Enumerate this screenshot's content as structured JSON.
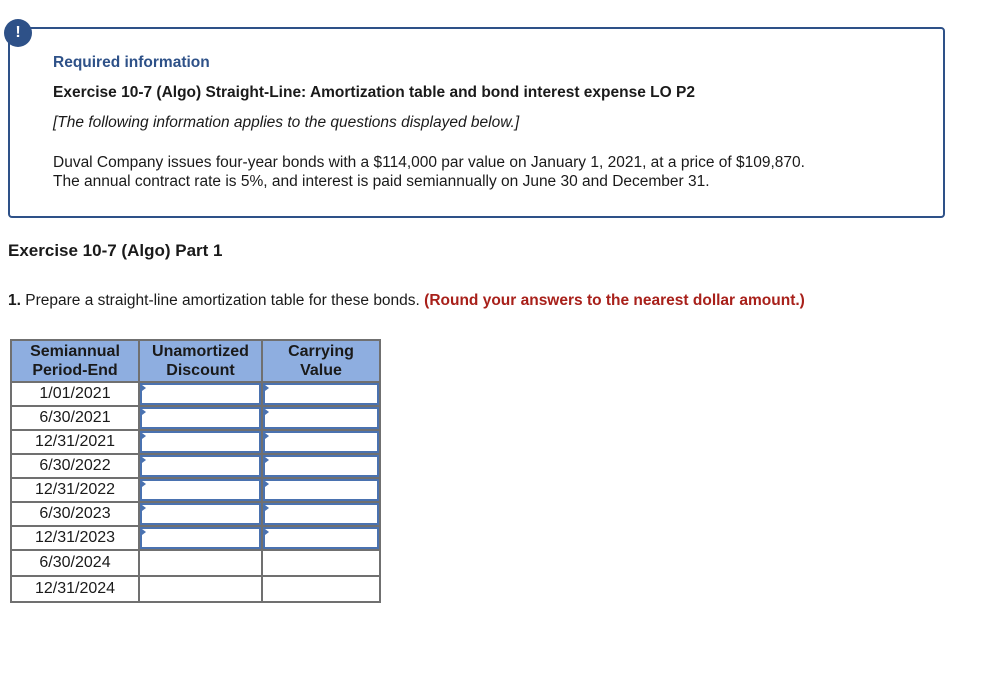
{
  "info_box": {
    "alert_icon": "!",
    "required_label": "Required information",
    "exercise_title": "Exercise 10-7 (Algo) Straight-Line: Amortization table and bond interest expense LO P2",
    "note": "[The following information applies to the questions displayed below.]",
    "description_line1": "Duval Company issues four-year bonds with a $114,000 par value on January 1, 2021, at a price of $109,870.",
    "description_line2": "The annual contract rate is 5%, and interest is paid semiannually on June 30 and December 31."
  },
  "part_title": "Exercise 10-7 (Algo) Part 1",
  "question": {
    "number": "1.",
    "text": " Prepare a straight-line amortization table for these bonds. ",
    "instruction": "(Round your answers to the nearest dollar amount.)"
  },
  "table": {
    "headers": [
      {
        "line1": "Semiannual",
        "line2": "Period-End"
      },
      {
        "line1": "Unamortized",
        "line2": "Discount"
      },
      {
        "line1": "Carrying",
        "line2": "Value"
      }
    ],
    "rows": [
      {
        "date": "1/01/2021",
        "discount": "",
        "carrying": "",
        "editable": true
      },
      {
        "date": "6/30/2021",
        "discount": "",
        "carrying": "",
        "editable": true
      },
      {
        "date": "12/31/2021",
        "discount": "",
        "carrying": "",
        "editable": true
      },
      {
        "date": "6/30/2022",
        "discount": "",
        "carrying": "",
        "editable": true
      },
      {
        "date": "12/31/2022",
        "discount": "",
        "carrying": "",
        "editable": true
      },
      {
        "date": "6/30/2023",
        "discount": "",
        "carrying": "",
        "editable": true
      },
      {
        "date": "12/31/2023",
        "discount": "",
        "carrying": "",
        "editable": true
      },
      {
        "date": "6/30/2024",
        "discount": "",
        "carrying": "",
        "editable": false
      },
      {
        "date": "12/31/2024",
        "discount": "",
        "carrying": "",
        "editable": false
      }
    ]
  }
}
